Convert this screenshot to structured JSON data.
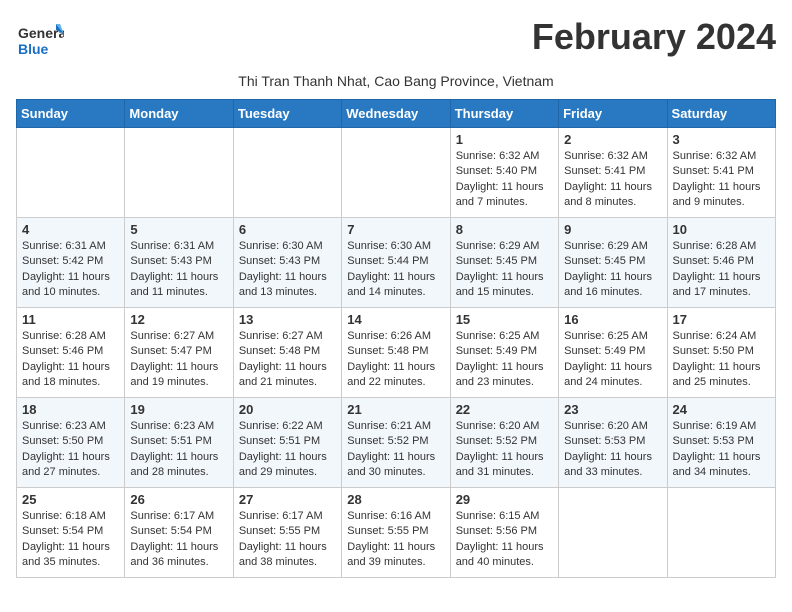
{
  "header": {
    "logo_general": "General",
    "logo_blue": "Blue",
    "title": "February 2024",
    "subtitle": "Thi Tran Thanh Nhat, Cao Bang Province, Vietnam"
  },
  "columns": [
    "Sunday",
    "Monday",
    "Tuesday",
    "Wednesday",
    "Thursday",
    "Friday",
    "Saturday"
  ],
  "weeks": [
    [
      {
        "day": "",
        "info": ""
      },
      {
        "day": "",
        "info": ""
      },
      {
        "day": "",
        "info": ""
      },
      {
        "day": "",
        "info": ""
      },
      {
        "day": "1",
        "info": "Sunrise: 6:32 AM\nSunset: 5:40 PM\nDaylight: 11 hours and 7 minutes."
      },
      {
        "day": "2",
        "info": "Sunrise: 6:32 AM\nSunset: 5:41 PM\nDaylight: 11 hours and 8 minutes."
      },
      {
        "day": "3",
        "info": "Sunrise: 6:32 AM\nSunset: 5:41 PM\nDaylight: 11 hours and 9 minutes."
      }
    ],
    [
      {
        "day": "4",
        "info": "Sunrise: 6:31 AM\nSunset: 5:42 PM\nDaylight: 11 hours and 10 minutes."
      },
      {
        "day": "5",
        "info": "Sunrise: 6:31 AM\nSunset: 5:43 PM\nDaylight: 11 hours and 11 minutes."
      },
      {
        "day": "6",
        "info": "Sunrise: 6:30 AM\nSunset: 5:43 PM\nDaylight: 11 hours and 13 minutes."
      },
      {
        "day": "7",
        "info": "Sunrise: 6:30 AM\nSunset: 5:44 PM\nDaylight: 11 hours and 14 minutes."
      },
      {
        "day": "8",
        "info": "Sunrise: 6:29 AM\nSunset: 5:45 PM\nDaylight: 11 hours and 15 minutes."
      },
      {
        "day": "9",
        "info": "Sunrise: 6:29 AM\nSunset: 5:45 PM\nDaylight: 11 hours and 16 minutes."
      },
      {
        "day": "10",
        "info": "Sunrise: 6:28 AM\nSunset: 5:46 PM\nDaylight: 11 hours and 17 minutes."
      }
    ],
    [
      {
        "day": "11",
        "info": "Sunrise: 6:28 AM\nSunset: 5:46 PM\nDaylight: 11 hours and 18 minutes."
      },
      {
        "day": "12",
        "info": "Sunrise: 6:27 AM\nSunset: 5:47 PM\nDaylight: 11 hours and 19 minutes."
      },
      {
        "day": "13",
        "info": "Sunrise: 6:27 AM\nSunset: 5:48 PM\nDaylight: 11 hours and 21 minutes."
      },
      {
        "day": "14",
        "info": "Sunrise: 6:26 AM\nSunset: 5:48 PM\nDaylight: 11 hours and 22 minutes."
      },
      {
        "day": "15",
        "info": "Sunrise: 6:25 AM\nSunset: 5:49 PM\nDaylight: 11 hours and 23 minutes."
      },
      {
        "day": "16",
        "info": "Sunrise: 6:25 AM\nSunset: 5:49 PM\nDaylight: 11 hours and 24 minutes."
      },
      {
        "day": "17",
        "info": "Sunrise: 6:24 AM\nSunset: 5:50 PM\nDaylight: 11 hours and 25 minutes."
      }
    ],
    [
      {
        "day": "18",
        "info": "Sunrise: 6:23 AM\nSunset: 5:50 PM\nDaylight: 11 hours and 27 minutes."
      },
      {
        "day": "19",
        "info": "Sunrise: 6:23 AM\nSunset: 5:51 PM\nDaylight: 11 hours and 28 minutes."
      },
      {
        "day": "20",
        "info": "Sunrise: 6:22 AM\nSunset: 5:51 PM\nDaylight: 11 hours and 29 minutes."
      },
      {
        "day": "21",
        "info": "Sunrise: 6:21 AM\nSunset: 5:52 PM\nDaylight: 11 hours and 30 minutes."
      },
      {
        "day": "22",
        "info": "Sunrise: 6:20 AM\nSunset: 5:52 PM\nDaylight: 11 hours and 31 minutes."
      },
      {
        "day": "23",
        "info": "Sunrise: 6:20 AM\nSunset: 5:53 PM\nDaylight: 11 hours and 33 minutes."
      },
      {
        "day": "24",
        "info": "Sunrise: 6:19 AM\nSunset: 5:53 PM\nDaylight: 11 hours and 34 minutes."
      }
    ],
    [
      {
        "day": "25",
        "info": "Sunrise: 6:18 AM\nSunset: 5:54 PM\nDaylight: 11 hours and 35 minutes."
      },
      {
        "day": "26",
        "info": "Sunrise: 6:17 AM\nSunset: 5:54 PM\nDaylight: 11 hours and 36 minutes."
      },
      {
        "day": "27",
        "info": "Sunrise: 6:17 AM\nSunset: 5:55 PM\nDaylight: 11 hours and 38 minutes."
      },
      {
        "day": "28",
        "info": "Sunrise: 6:16 AM\nSunset: 5:55 PM\nDaylight: 11 hours and 39 minutes."
      },
      {
        "day": "29",
        "info": "Sunrise: 6:15 AM\nSunset: 5:56 PM\nDaylight: 11 hours and 40 minutes."
      },
      {
        "day": "",
        "info": ""
      },
      {
        "day": "",
        "info": ""
      }
    ]
  ]
}
